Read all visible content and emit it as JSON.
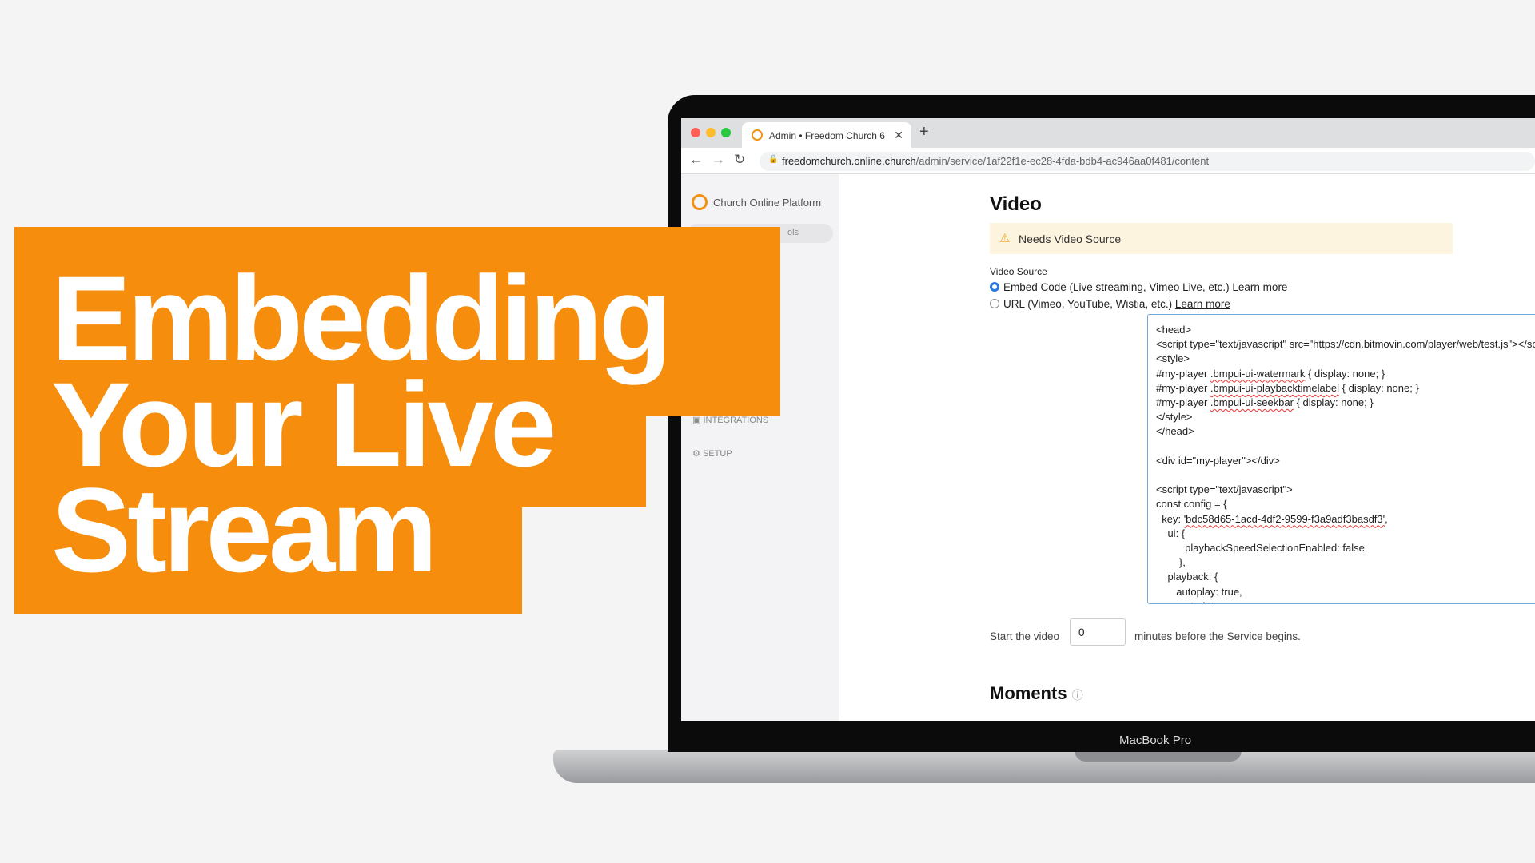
{
  "headline": {
    "line1": "Embedding",
    "line2": "Your Live",
    "line3": "Stream"
  },
  "brand_color": "#f68d0c",
  "browser": {
    "tab_title": "Admin • Freedom Church 6",
    "url_host": "freedomchurch.online.church",
    "url_path": "/admin/service/1af22f1e-ec28-4fda-bdb4-ac946aa0f481/content"
  },
  "sidebar": {
    "brand": "Church Online Platform",
    "items": [
      {
        "label": "ols"
      },
      {
        "label": "INTEGRATIONS"
      },
      {
        "label": "SETUP"
      }
    ]
  },
  "main": {
    "title": "Video",
    "warning": "Needs Video Source",
    "source_label": "Video Source",
    "options": [
      {
        "label": "Embed Code (Live streaming, Vimeo Live, etc.)",
        "link": "Learn more",
        "selected": true
      },
      {
        "label": "URL (Vimeo, YouTube, Wistia, etc.)",
        "link": "Learn more",
        "selected": false
      }
    ],
    "code_lines": [
      "<head>",
      "<script type=\"text/javascript\" src=\"https://cdn.bitmovin.com/player/web/test.js\"></script>",
      "<style>",
      "#my-player .bmpui-ui-watermark { display: none; }",
      "#my-player .bmpui-ui-playbacktimelabel { display: none; }",
      "#my-player .bmpui-ui-seekbar { display: none; }",
      "</style>",
      "</head>",
      "",
      "<div id=\"my-player\"></div>",
      "",
      "<script type=\"text/javascript\">",
      "const config = {",
      "  key: 'bdc58d65-1acd-4df2-9599-f3a9adf3basdf3',",
      "    ui: {",
      "          playbackSpeedSelectionEnabled: false",
      "        },",
      "    playback: {",
      "       autoplay: true,",
      "       muted: true"
    ],
    "start_prefix": "Start the video",
    "start_value": "0",
    "start_suffix": "minutes before the Service begins.",
    "moments": "Moments"
  },
  "device_label": "MacBook Pro"
}
